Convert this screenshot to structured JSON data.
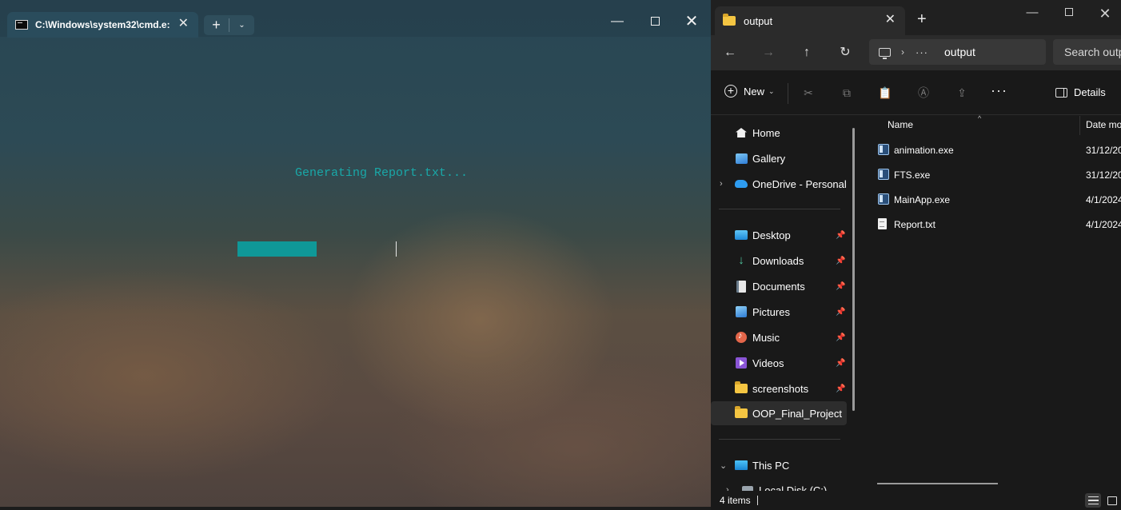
{
  "terminal": {
    "tab_title": "C:\\Windows\\system32\\cmd.e:",
    "tab_close": "✕",
    "new_tab": "+",
    "new_tab_dropdown": "⌄",
    "minimize": "—",
    "close": "✕",
    "output_text": "Generating Report.txt...",
    "progress": 0.5,
    "accent_color": "#19a8a8"
  },
  "explorer": {
    "tab_title": "output",
    "tab_close": "✕",
    "new_tab": "+",
    "minimize": "—",
    "close": "✕",
    "nav": {
      "back": "←",
      "forward": "→",
      "up": "↑",
      "refresh": "↻",
      "chevron": "›",
      "overflow": "···",
      "current_folder": "output",
      "search_placeholder": "Search outp"
    },
    "command_bar": {
      "new_label": "New",
      "new_caret": "⌄",
      "more": "···",
      "details_label": "Details",
      "icons": [
        "scissors-icon",
        "copy-icon",
        "paste-icon",
        "rename-icon",
        "share-icon"
      ]
    },
    "sidebar": {
      "items": [
        {
          "label": "Home",
          "icon": "home-icon"
        },
        {
          "label": "Gallery",
          "icon": "gallery-icon"
        },
        {
          "label": "OneDrive - Personal",
          "icon": "onedrive-icon",
          "expand": "›"
        },
        {
          "label": "Desktop",
          "icon": "desktop-icon",
          "pin": "📌"
        },
        {
          "label": "Downloads",
          "icon": "download-icon",
          "pin": "📌"
        },
        {
          "label": "Documents",
          "icon": "documents-icon",
          "pin": "📌"
        },
        {
          "label": "Pictures",
          "icon": "pictures-icon",
          "pin": "📌"
        },
        {
          "label": "Music",
          "icon": "music-icon",
          "pin": "📌"
        },
        {
          "label": "Videos",
          "icon": "videos-icon",
          "pin": "📌"
        },
        {
          "label": "screenshots",
          "icon": "folder-icon",
          "pin": "📌"
        },
        {
          "label": "OOP_Final_Project",
          "icon": "folder-icon"
        },
        {
          "label": "This PC",
          "icon": "this-pc-icon",
          "expand": "⌄"
        },
        {
          "label": "Local Disk (C:)",
          "icon": "disk-icon",
          "expand": "›"
        }
      ]
    },
    "file_list": {
      "columns": [
        "Name",
        "Date mo"
      ],
      "sort_indicator": "^",
      "files": [
        {
          "name": "animation.exe",
          "date": "31/12/20",
          "icon": "exe-icon"
        },
        {
          "name": "FTS.exe",
          "date": "31/12/20",
          "icon": "exe-icon"
        },
        {
          "name": "MainApp.exe",
          "date": "4/1/2024",
          "icon": "exe-icon"
        },
        {
          "name": "Report.txt",
          "date": "4/1/2024",
          "icon": "txt-icon"
        }
      ]
    },
    "status": {
      "item_count": "4 items"
    }
  }
}
